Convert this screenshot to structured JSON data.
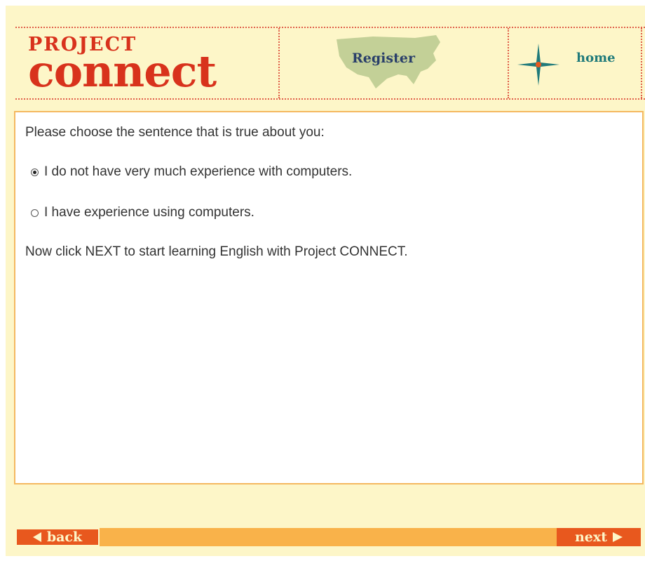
{
  "header": {
    "logo_top": "PROJECT",
    "logo_main": "connect",
    "register_label": "Register",
    "home_label": "home"
  },
  "content": {
    "prompt": "Please choose the sentence that is true about you:",
    "options": [
      {
        "label": "I do not have very much experience with computers.",
        "selected": true
      },
      {
        "label": "I have experience using computers.",
        "selected": false
      }
    ],
    "instruction": "Now click NEXT to start learning English with Project CONNECT."
  },
  "footer": {
    "back_label": "back",
    "next_label": "next"
  },
  "colors": {
    "background": "#fdf6c8",
    "logo_red": "#d8321c",
    "nav_orange": "#e8581e",
    "bar_orange": "#f9b24a",
    "register_navy": "#2a3f6a",
    "home_teal": "#1f7a7a"
  },
  "icons": {
    "register_bg": "usa-map-icon",
    "home": "compass-star-icon",
    "back": "left-arrow-icon",
    "next": "right-arrow-icon"
  }
}
